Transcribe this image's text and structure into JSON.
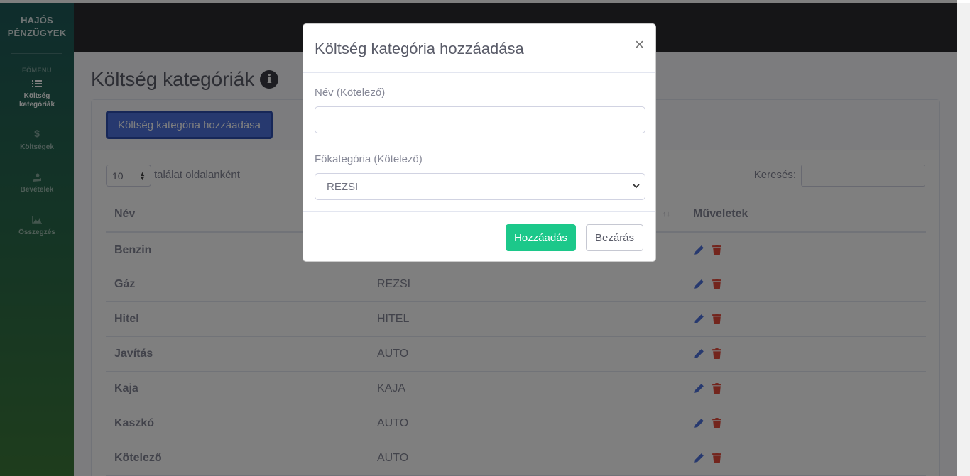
{
  "brand": {
    "line1": "HAJÓS",
    "line2": "PÉNZÜGYEK"
  },
  "sidebar": {
    "heading": "FŐMENÜ",
    "items": [
      {
        "label_line1": "Költség",
        "label_line2": "kategóriák",
        "icon": "list-icon",
        "active": true
      },
      {
        "label_line1": "Költségek",
        "label_line2": "",
        "icon": "dollar-icon",
        "active": false
      },
      {
        "label_line1": "Bevételek",
        "label_line2": "",
        "icon": "hand-holding-dollar-icon",
        "active": false
      },
      {
        "label_line1": "Összegzés",
        "label_line2": "",
        "icon": "chart-area-icon",
        "active": false
      }
    ]
  },
  "page": {
    "title": "Költség kategóriák",
    "info_icon": "i"
  },
  "card": {
    "add_button": "Költség kategória hozzáadása"
  },
  "table_controls": {
    "page_length": "10",
    "page_length_label": "találat oldalanként",
    "search_label": "Keresés:"
  },
  "table": {
    "headers": [
      "Név",
      "",
      "Műveletek"
    ],
    "rows": [
      {
        "name": "Benzin",
        "category": ""
      },
      {
        "name": "Gáz",
        "category": "REZSI"
      },
      {
        "name": "Hitel",
        "category": "HITEL"
      },
      {
        "name": "Javítás",
        "category": "AUTO"
      },
      {
        "name": "Kaja",
        "category": "KAJA"
      },
      {
        "name": "Kaszkó",
        "category": "AUTO"
      },
      {
        "name": "Kötelező",
        "category": "AUTO"
      }
    ]
  },
  "modal": {
    "title": "Költség kategória hozzáadása",
    "close": "×",
    "name_label": "Név (Kötelező)",
    "name_value": "",
    "category_label": "Főkategória (Kötelező)",
    "category_selected": "REZSI",
    "submit_label": "Hozzáadás",
    "close_label": "Bezárás"
  },
  "colors": {
    "primary": "#4e73df",
    "success": "#1cc88a",
    "danger": "#e74a3b",
    "topbar": "#2b2b2e"
  }
}
